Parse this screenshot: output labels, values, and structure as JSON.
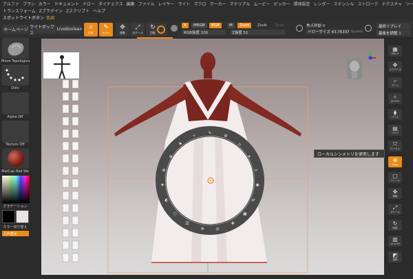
{
  "menu1": [
    "アルファ",
    "ブラシ",
    "カラー",
    "ドキュメント",
    "ドロー",
    "ダイナミクス",
    "編集",
    "ファイル",
    "レイヤー",
    "ライト",
    "マクロ",
    "マーカー",
    "マテリアル",
    "ムービー",
    "ピッカー",
    "環境設定",
    "レンダー",
    "ステンシル",
    "ストローク",
    "テクスチャ",
    "ツール"
  ],
  "menu2": [
    "トランスフォーム",
    "Zプラグイン",
    "Zスクリプト",
    "ヘルプ"
  ],
  "spotlight": {
    "label": "スポットライトボタン",
    "value": "色調"
  },
  "tabs": {
    "home": "ホームページ",
    "lightbox": "ライトボックス",
    "liveboolean": "LiveBoolean"
  },
  "toolbar": {
    "edit": "Edit",
    "draw": "ドロー",
    "move": "移動",
    "scale": "スケール",
    "rotate": "回転",
    "a": "A",
    "mrgb": "MRGB",
    "rgb": "RGB",
    "m": "M",
    "zadd": "Zadd",
    "zsub": "Zsub",
    "zcut": "Zcut",
    "rgb_intensity": "RGB強度 100",
    "z_intensity": "Z強度 51",
    "focal_shift": "焦点移動 0",
    "draw_size": "ドローサイズ 43.76337",
    "dynamic": "Dynamic"
  },
  "right_top": {
    "replay": "最終リプレイ",
    "adjust": "最後を調整 1"
  },
  "left_panel": {
    "brush": "Move Topologica",
    "stroke": "Dots",
    "alpha": "Alpha Off",
    "texture": "Texture Off",
    "material": "MatCap Red Wa",
    "gradient": "グラデーション",
    "switch_color": "カラー切り替え",
    "swap": "入れ替え"
  },
  "right_panel": [
    {
      "icon": "spix",
      "label": "SPix 3"
    },
    {
      "icon": "scroll",
      "label": "スクロール"
    },
    {
      "icon": "zoom",
      "label": "ズーム"
    },
    {
      "icon": "zoom-ac",
      "label": "AC50%"
    },
    {
      "icon": "perspective",
      "label": "パース"
    },
    {
      "icon": "floor",
      "label": "フロア"
    },
    {
      "icon": "local",
      "label": "ローカル"
    },
    {
      "icon": "xyz",
      "label": "Qxyz"
    },
    {
      "icon": "frame",
      "label": "フレーム"
    },
    {
      "icon": "move",
      "label": "移動"
    },
    {
      "icon": "scale",
      "label": "スケール"
    },
    {
      "icon": "rotate",
      "label": "回転"
    },
    {
      "icon": "linefill",
      "label": "Line Fill"
    },
    {
      "icon": "transp",
      "label": "透明"
    }
  ],
  "tooltip": "ローカルシンメトリを使用します",
  "colors": {
    "accent": "#e98a1a",
    "skin": "#8a2a22",
    "dress": "#f3ecec",
    "ring": "#4a4a4a"
  }
}
